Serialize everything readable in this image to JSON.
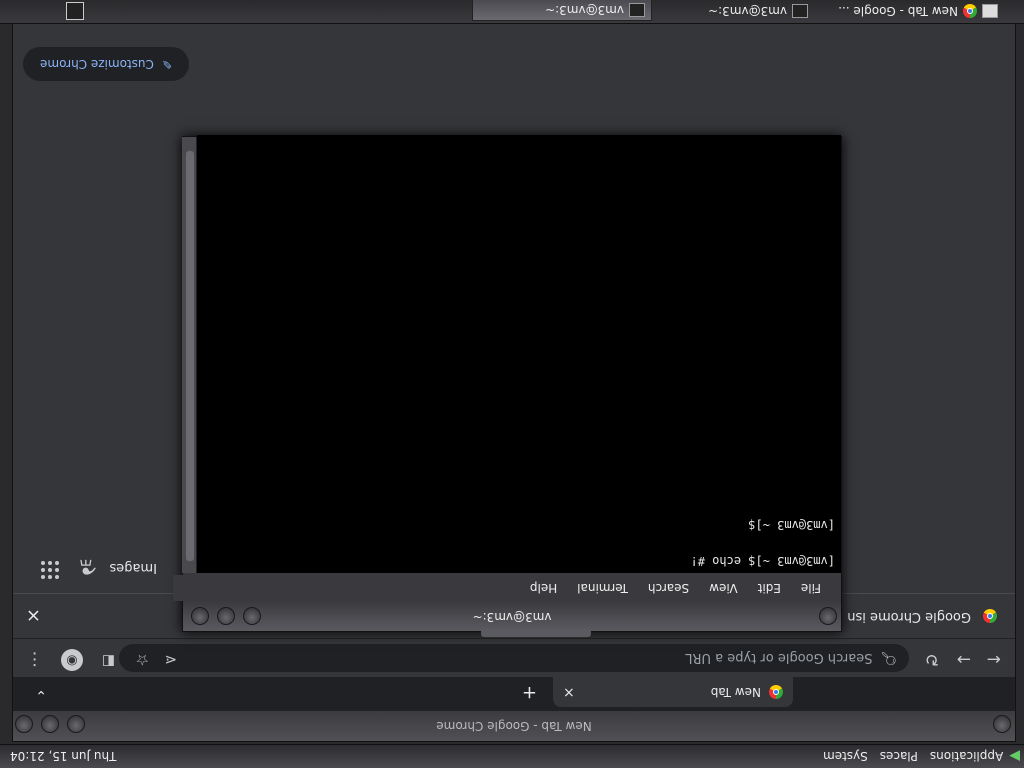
{
  "top_panel": {
    "menus": [
      "Applications",
      "Places",
      "System"
    ],
    "clock": "Thu Jun 15, 21:04"
  },
  "taskbar": {
    "tasks": [
      {
        "label": "New Tab - Google ...",
        "icon": "chrome-icon",
        "active": false
      },
      {
        "label": "vm3@vm3:~",
        "icon": "terminal-icon",
        "active": false
      },
      {
        "label": "vm3@vm3:~",
        "icon": "terminal-icon",
        "active": true
      }
    ]
  },
  "chrome": {
    "window_title": "New Tab - Google Chrome",
    "tab": {
      "title": "New Tab",
      "close": "×"
    },
    "new_tab": "+",
    "omnibox_placeholder": "Search Google or type a URL",
    "infobar_text": "Google Chrome isn",
    "infobar_close": "×",
    "images_link": "Images",
    "customize_label": "Customize Chrome"
  },
  "terminal": {
    "title": "vm3@vm3:~",
    "menus": [
      "File",
      "Edit",
      "View",
      "Search",
      "Terminal",
      "Help"
    ],
    "lines": [
      "[vm3@vm3 ~]$ echo #!",
      "[vm3@vm3 ~]$ "
    ]
  }
}
